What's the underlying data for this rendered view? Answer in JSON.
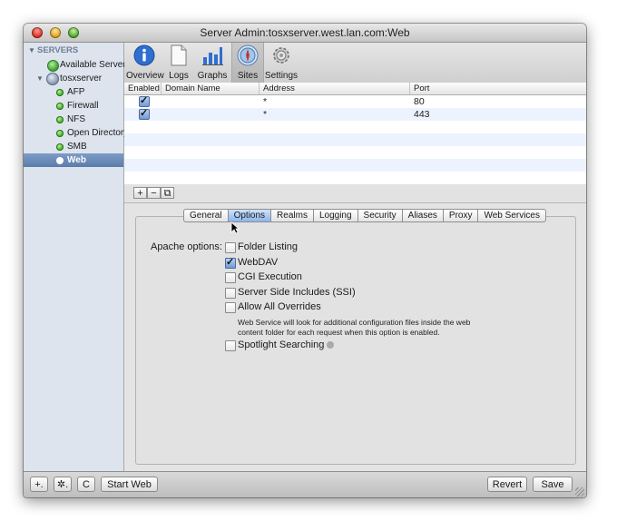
{
  "window": {
    "title": "Server Admin:tosxserver.west.lan.com:Web"
  },
  "sidebar": {
    "header": "SERVERS",
    "available_servers": "Available Servers",
    "server": "tosxserver",
    "services": [
      {
        "label": "AFP"
      },
      {
        "label": "Firewall"
      },
      {
        "label": "NFS"
      },
      {
        "label": "Open Directory"
      },
      {
        "label": "SMB"
      },
      {
        "label": "Web",
        "selected": true
      }
    ]
  },
  "toolbar": {
    "items": [
      {
        "label": "Overview",
        "icon": "info-icon"
      },
      {
        "label": "Logs",
        "icon": "document-icon"
      },
      {
        "label": "Graphs",
        "icon": "bar-chart-icon"
      },
      {
        "label": "Sites",
        "icon": "compass-icon",
        "active": true
      },
      {
        "label": "Settings",
        "icon": "gear-icon"
      }
    ]
  },
  "sites_table": {
    "columns": [
      "Enabled",
      "Domain Name",
      "Address",
      "Port"
    ],
    "rows": [
      {
        "enabled": true,
        "domain": "",
        "address": "*",
        "port": "80"
      },
      {
        "enabled": true,
        "domain": "",
        "address": "*",
        "port": "443"
      }
    ]
  },
  "table_tools": {
    "add": "+",
    "remove": "−",
    "duplicate": "⧉"
  },
  "tabs": {
    "items": [
      "General",
      "Options",
      "Realms",
      "Logging",
      "Security",
      "Aliases",
      "Proxy",
      "Web Services"
    ],
    "active": "Options"
  },
  "options": {
    "label": "Apache options:",
    "items": [
      {
        "label": "Folder Listing",
        "checked": false
      },
      {
        "label": "WebDAV",
        "checked": true
      },
      {
        "label": "CGI Execution",
        "checked": false
      },
      {
        "label": "Server Side Includes (SSI)",
        "checked": false
      },
      {
        "label": "Allow All Overrides",
        "checked": false
      },
      {
        "label": "Spotlight Searching",
        "checked": false
      }
    ],
    "overrides_note": "Web Service will look for additional configuration files inside the web content folder for each request when this option is enabled."
  },
  "bottom": {
    "add": "+.",
    "action": "✲.",
    "refresh": "C",
    "start": "Start Web",
    "revert": "Revert",
    "save": "Save"
  },
  "colors": {
    "selection": "#5b7cab",
    "sidebar": "#dde4ee",
    "row_alt": "#edf3fe"
  }
}
